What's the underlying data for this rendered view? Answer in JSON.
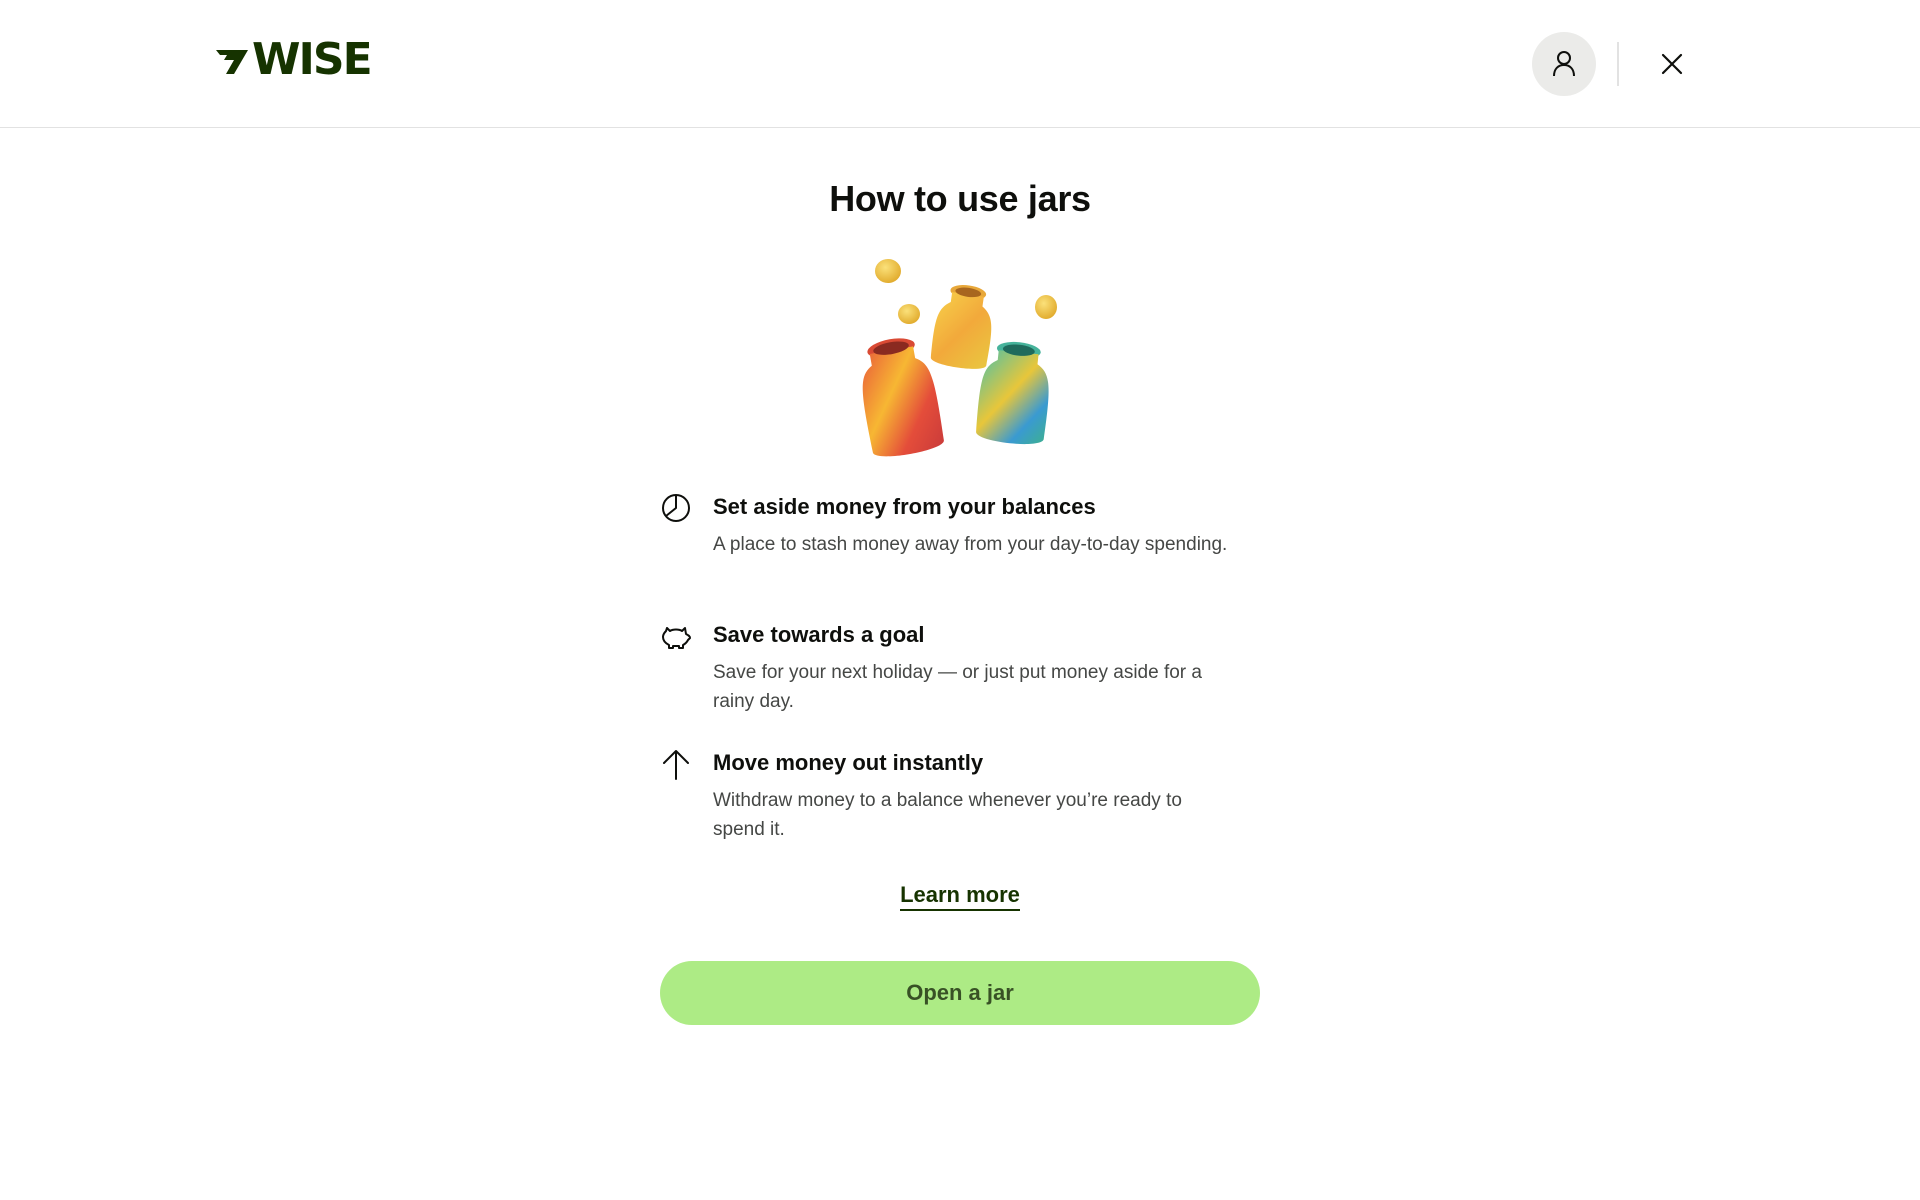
{
  "header": {
    "logo_text": "WISE",
    "account_icon": "person-icon",
    "close_icon": "close-icon"
  },
  "main": {
    "title": "How to use jars",
    "illustration": "jars-with-coins",
    "features": [
      {
        "icon": "pie-chart-icon",
        "title": "Set aside money from your balances",
        "description": "A place to stash money away from your day-to-day spending."
      },
      {
        "icon": "piggy-bank-icon",
        "title": "Save towards a goal",
        "description": "Save for your next holiday — or just put money aside for a rainy day."
      },
      {
        "icon": "arrow-up-icon",
        "title": "Move money out instantly",
        "description": "Withdraw money to a balance whenever you’re ready to spend it."
      }
    ],
    "learn_more_label": "Learn more",
    "open_jar_label": "Open a jar"
  },
  "colors": {
    "brand": "#163300",
    "primary_button": "#9fe870",
    "text": "#0e0f0c",
    "secondary_text": "#454745"
  }
}
